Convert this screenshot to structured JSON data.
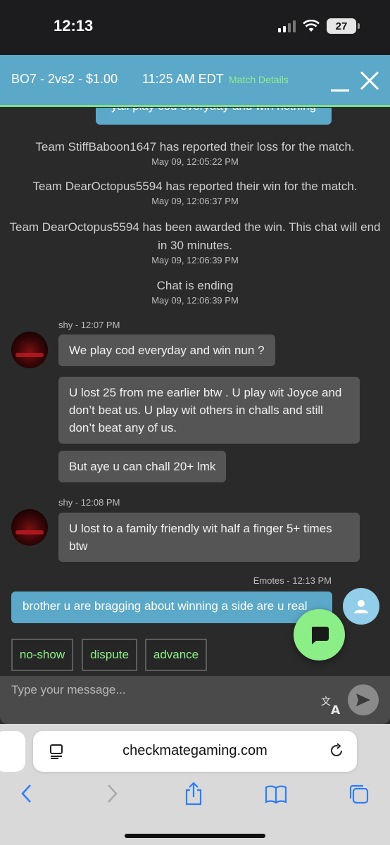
{
  "status": {
    "time": "12:13",
    "battery": "27"
  },
  "header": {
    "match_title": "BO7 - 2vs2 - $1.00",
    "match_time": "11:25 AM EDT",
    "match_details_link": "Match Details"
  },
  "chat": {
    "partial_top_message": "yall play cod everyday and win nothing",
    "system_messages": [
      {
        "text": "Team StiffBaboon1647 has reported their loss for the match.",
        "time": "May 09, 12:05:22 PM"
      },
      {
        "text": "Team DearOctopus5594 has reported their win for the match.",
        "time": "May 09, 12:06:37 PM"
      },
      {
        "text": "Team DearOctopus5594 has been awarded the win. This chat will end in 30 minutes.",
        "time": "May 09, 12:06:39 PM"
      },
      {
        "text": "Chat is ending",
        "time": "May 09, 12:06:39 PM"
      }
    ],
    "groups": [
      {
        "meta": "shy - 12:07 PM",
        "messages": [
          "We play cod everyday and win nun ?",
          "U lost 25 from me earlier btw . U play wit Joyce and don’t beat us. U play wit others in challs and still don’t beat any of us.",
          "But aye u can chall 20+ lmk"
        ]
      },
      {
        "meta": "shy - 12:08 PM",
        "messages": [
          "U lost to a family friendly wit half a finger 5+ times btw"
        ]
      }
    ],
    "my_message": {
      "meta": "Emotes - 12:13 PM",
      "text": "brother u are bragging about winning a side are u real"
    }
  },
  "quick_actions": [
    "no-show",
    "dispute",
    "advance"
  ],
  "input": {
    "placeholder": "Type your message..."
  },
  "browser": {
    "url": "checkmategaming.com"
  },
  "colors": {
    "accent_blue": "#5ba8c8",
    "accent_green": "#8ff08a",
    "bubble_gray": "#555555"
  }
}
